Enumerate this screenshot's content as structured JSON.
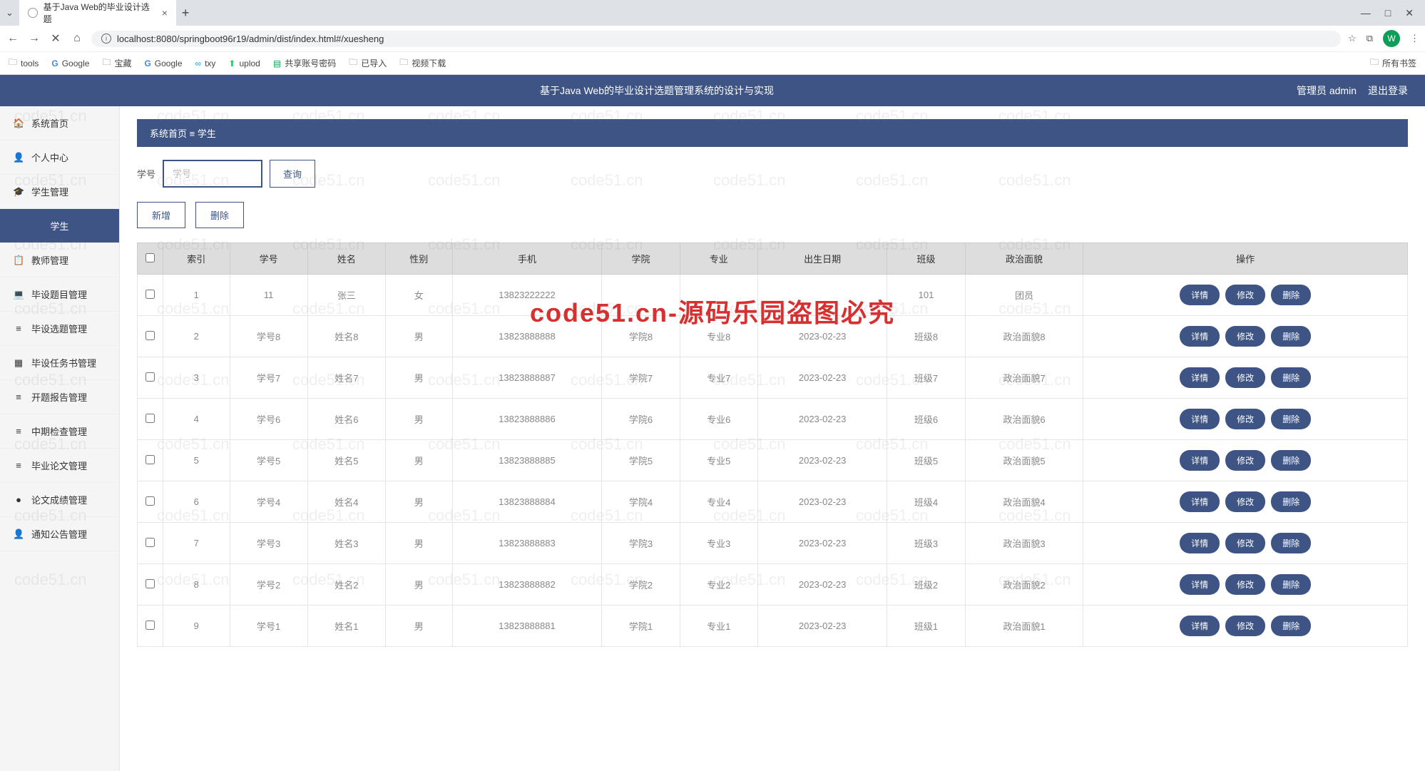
{
  "browser": {
    "tab_title": "基于Java Web的毕业设计选题",
    "url": "localhost:8080/springboot96r19/admin/dist/index.html#/xuesheng",
    "avatar_letter": "W",
    "bookmarks": [
      {
        "icon": "folder",
        "label": "tools"
      },
      {
        "icon": "g",
        "label": "Google"
      },
      {
        "icon": "folder",
        "label": "宝藏"
      },
      {
        "icon": "g",
        "label": "Google"
      },
      {
        "icon": "bird",
        "label": "txy"
      },
      {
        "icon": "up",
        "label": "uplod"
      },
      {
        "icon": "green",
        "label": "共享账号密码"
      },
      {
        "icon": "folder",
        "label": "已导入"
      },
      {
        "icon": "folder",
        "label": "视频下载"
      }
    ],
    "bookmarks_right": "所有书签"
  },
  "header": {
    "title": "基于Java Web的毕业设计选题管理系统的设计与实现",
    "user_label": "管理员 admin",
    "logout": "退出登录"
  },
  "sidebar": {
    "items": [
      {
        "icon": "🏠",
        "label": "系统首页"
      },
      {
        "icon": "👤",
        "label": "个人中心"
      },
      {
        "icon": "🎓",
        "label": "学生管理"
      },
      {
        "icon": "",
        "label": "学生",
        "sub": true,
        "active": true
      },
      {
        "icon": "📋",
        "label": "教师管理"
      },
      {
        "icon": "💻",
        "label": "毕设题目管理"
      },
      {
        "icon": "≡",
        "label": "毕设选题管理"
      },
      {
        "icon": "▦",
        "label": "毕设任务书管理"
      },
      {
        "icon": "≡",
        "label": "开题报告管理"
      },
      {
        "icon": "≡",
        "label": "中期检查管理"
      },
      {
        "icon": "≡",
        "label": "毕业论文管理"
      },
      {
        "icon": "●",
        "label": "论文成绩管理"
      },
      {
        "icon": "👤",
        "label": "通知公告管理"
      }
    ]
  },
  "breadcrumb": {
    "home": "系统首页",
    "sep": "≡",
    "current": "学生"
  },
  "search": {
    "label": "学号",
    "placeholder": "学号",
    "button": "查询"
  },
  "actions": {
    "add": "新增",
    "delete": "删除"
  },
  "table": {
    "columns": [
      "索引",
      "学号",
      "姓名",
      "性别",
      "手机",
      "学院",
      "专业",
      "出生日期",
      "班级",
      "政治面貌",
      "操作"
    ],
    "op_labels": {
      "detail": "详情",
      "edit": "修改",
      "delete": "删除"
    },
    "rows": [
      {
        "idx": "1",
        "xh": "11",
        "name": "张三",
        "sex": "女",
        "phone": "13823222222",
        "college": "",
        "major": "",
        "birth": "",
        "clazz": "101",
        "pol": "团员"
      },
      {
        "idx": "2",
        "xh": "学号8",
        "name": "姓名8",
        "sex": "男",
        "phone": "13823888888",
        "college": "学院8",
        "major": "专业8",
        "birth": "2023-02-23",
        "clazz": "班级8",
        "pol": "政治面貌8"
      },
      {
        "idx": "3",
        "xh": "学号7",
        "name": "姓名7",
        "sex": "男",
        "phone": "13823888887",
        "college": "学院7",
        "major": "专业7",
        "birth": "2023-02-23",
        "clazz": "班级7",
        "pol": "政治面貌7"
      },
      {
        "idx": "4",
        "xh": "学号6",
        "name": "姓名6",
        "sex": "男",
        "phone": "13823888886",
        "college": "学院6",
        "major": "专业6",
        "birth": "2023-02-23",
        "clazz": "班级6",
        "pol": "政治面貌6"
      },
      {
        "idx": "5",
        "xh": "学号5",
        "name": "姓名5",
        "sex": "男",
        "phone": "13823888885",
        "college": "学院5",
        "major": "专业5",
        "birth": "2023-02-23",
        "clazz": "班级5",
        "pol": "政治面貌5"
      },
      {
        "idx": "6",
        "xh": "学号4",
        "name": "姓名4",
        "sex": "男",
        "phone": "13823888884",
        "college": "学院4",
        "major": "专业4",
        "birth": "2023-02-23",
        "clazz": "班级4",
        "pol": "政治面貌4"
      },
      {
        "idx": "7",
        "xh": "学号3",
        "name": "姓名3",
        "sex": "男",
        "phone": "13823888883",
        "college": "学院3",
        "major": "专业3",
        "birth": "2023-02-23",
        "clazz": "班级3",
        "pol": "政治面貌3"
      },
      {
        "idx": "8",
        "xh": "学号2",
        "name": "姓名2",
        "sex": "男",
        "phone": "13823888882",
        "college": "学院2",
        "major": "专业2",
        "birth": "2023-02-23",
        "clazz": "班级2",
        "pol": "政治面貌2"
      },
      {
        "idx": "9",
        "xh": "学号1",
        "name": "姓名1",
        "sex": "男",
        "phone": "13823888881",
        "college": "学院1",
        "major": "专业1",
        "birth": "2023-02-23",
        "clazz": "班级1",
        "pol": "政治面貌1"
      }
    ]
  },
  "watermark": {
    "main": "code51.cn-源码乐园盗图必究",
    "bg": "code51.cn"
  }
}
